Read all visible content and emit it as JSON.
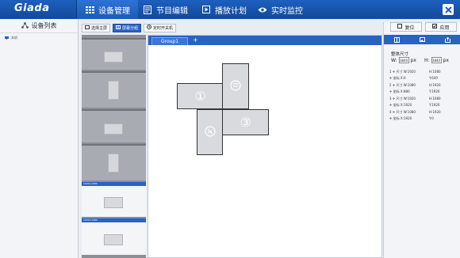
{
  "app": {
    "logo": "Giada"
  },
  "nav": {
    "device": "设备管理",
    "program": "节目编辑",
    "schedule": "播放计划",
    "monitor": "实时监控"
  },
  "left": {
    "title": "设备列表",
    "item": "本机"
  },
  "toolbar": {
    "select_main": "选择主屏",
    "screen_group": "屏幕分组",
    "timer_power": "定时开关机"
  },
  "thumbnails": {
    "label_5": "1920×1080",
    "label_6": "1920×1080"
  },
  "canvas": {
    "tab": "Group1",
    "add": "+",
    "screens": {
      "one": "①",
      "three": "③"
    }
  },
  "right": {
    "reset": "复位",
    "apply": "应用",
    "props_title": "整体尺寸",
    "w_label": "W:",
    "w_value": "3840",
    "h_label": "H:",
    "h_value": "3840",
    "unit": "px",
    "items": [
      {
        "a": "1  ✢  尺寸 W:1920",
        "b": "H:1080"
      },
      {
        "a": "    ✢  坐标 X:0",
        "b": "Y:640"
      },
      {
        "a": "2  ✢  尺寸 W:1080",
        "b": "H:1920"
      },
      {
        "a": "    ✢  坐标 X:880",
        "b": "Y:1920"
      },
      {
        "a": "3  ✢  尺寸 W:1920",
        "b": "H:1080"
      },
      {
        "a": "    ✢  坐标 X:1920",
        "b": "Y:1920"
      },
      {
        "a": "4  ✢  尺寸 W:1080",
        "b": "H:1920"
      },
      {
        "a": "    ✢  坐标 X:1920",
        "b": "Y:0"
      }
    ]
  },
  "colors": {
    "accent": "#2a62c4",
    "topbar": "#1d5fbf"
  }
}
